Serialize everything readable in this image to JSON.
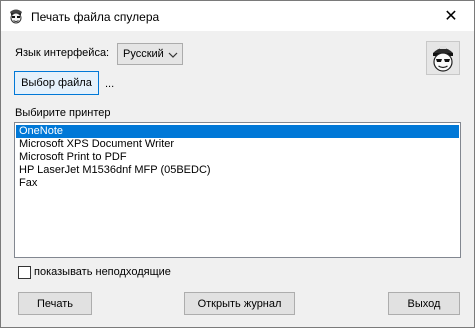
{
  "window": {
    "title": "Печать файла спулера",
    "close_label": "✕"
  },
  "language": {
    "label": "Язык интерфейса:",
    "selected": "Русский"
  },
  "file": {
    "button_label": "Выбор файла",
    "path": "..."
  },
  "printers": {
    "label": "Выбирите принтер",
    "items": [
      {
        "name": "OneNote",
        "selected": true
      },
      {
        "name": "Microsoft XPS Document Writer",
        "selected": false
      },
      {
        "name": "Microsoft Print to PDF",
        "selected": false
      },
      {
        "name": "HP LaserJet M1536dnf MFP (05BEDC)",
        "selected": false
      },
      {
        "name": "Fax",
        "selected": false
      }
    ]
  },
  "options": {
    "show_unsuitable_label": "показывать неподходящие",
    "show_unsuitable_checked": false
  },
  "buttons": {
    "print": "Печать",
    "open_journal": "Открыть журнал",
    "exit": "Выход"
  },
  "colors": {
    "selection": "#0078d7",
    "window_bg": "#f0f0f0"
  }
}
